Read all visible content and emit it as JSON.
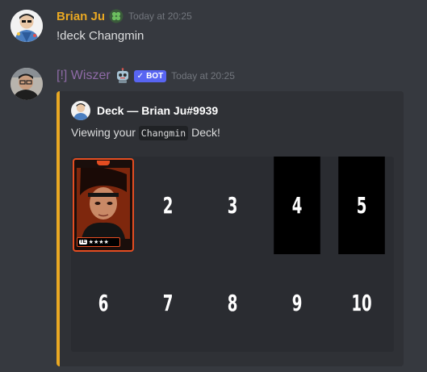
{
  "messages": [
    {
      "author": "Brian Ju",
      "author_color": "#e9a823",
      "timestamp": "Today at 20:25",
      "content": "!deck Changmin",
      "badge_icon": "clover-icon"
    },
    {
      "author": "[!] Wiszer",
      "author_color": "#8e6aa6",
      "timestamp": "Today at 20:25",
      "bot_tag": "BOT",
      "bot_check": "✓",
      "badge_icon": "robot-icon",
      "embed": {
        "accent": "#e9a823",
        "author_line": "Deck — Brian Ju#9939",
        "desc_pre": "Viewing your",
        "desc_code": "Changmin",
        "desc_post": "Deck!",
        "slots": [
          "2",
          "3",
          "4",
          "5",
          "6",
          "7",
          "8",
          "9",
          "10"
        ],
        "card": {
          "rarity": "★★★★",
          "badge": "TE"
        }
      }
    }
  ]
}
